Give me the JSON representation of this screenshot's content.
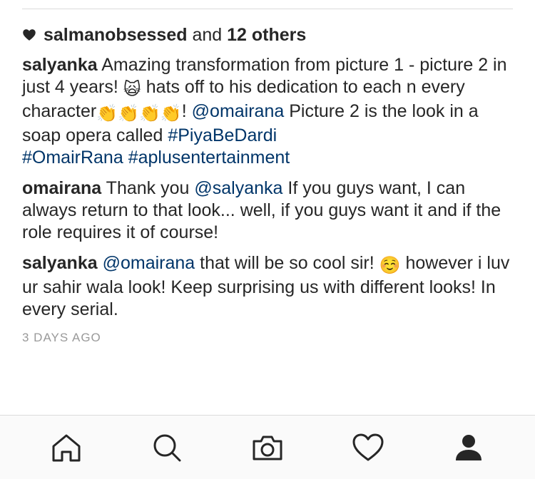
{
  "likes": {
    "icon": "heart-filled-icon",
    "first_user": "salmanobsessed",
    "connector": " and ",
    "others": "12 others"
  },
  "comments": [
    {
      "user": "salyanka",
      "text_1": "Amazing transformation from picture 1 - picture 2 in just 4 years! ",
      "emoji_1": "🙀",
      "text_2": " hats off to his dedication to each n every character",
      "emoji_2": "👏👏👏👏",
      "text_3": "! ",
      "mention": "@omairana",
      "text_4": " Picture 2 is the look in a soap opera called ",
      "hashtag_1": "#PiyaBeDardi",
      "hashtag_2": "#OmairRana",
      "hashtag_3": "#aplusentertainment"
    },
    {
      "user": "omairana",
      "text_1": "Thank you ",
      "mention": "@salyanka",
      "text_2": " If you guys want, I can always return to that look... well, if you guys want it and if the role requires it of course!"
    },
    {
      "user": "salyanka",
      "mention": "@omairana",
      "text_1": " that will be so cool sir! ",
      "emoji_1": "☺️",
      "text_2": " however i luv ur sahir wala look! Keep surprising us with different looks! In every serial."
    }
  ],
  "timestamp": "3 DAYS AGO",
  "tabbar": {
    "items": [
      {
        "icon": "home-icon"
      },
      {
        "icon": "search-icon"
      },
      {
        "icon": "camera-icon"
      },
      {
        "icon": "heart-icon"
      },
      {
        "icon": "profile-icon"
      }
    ]
  }
}
